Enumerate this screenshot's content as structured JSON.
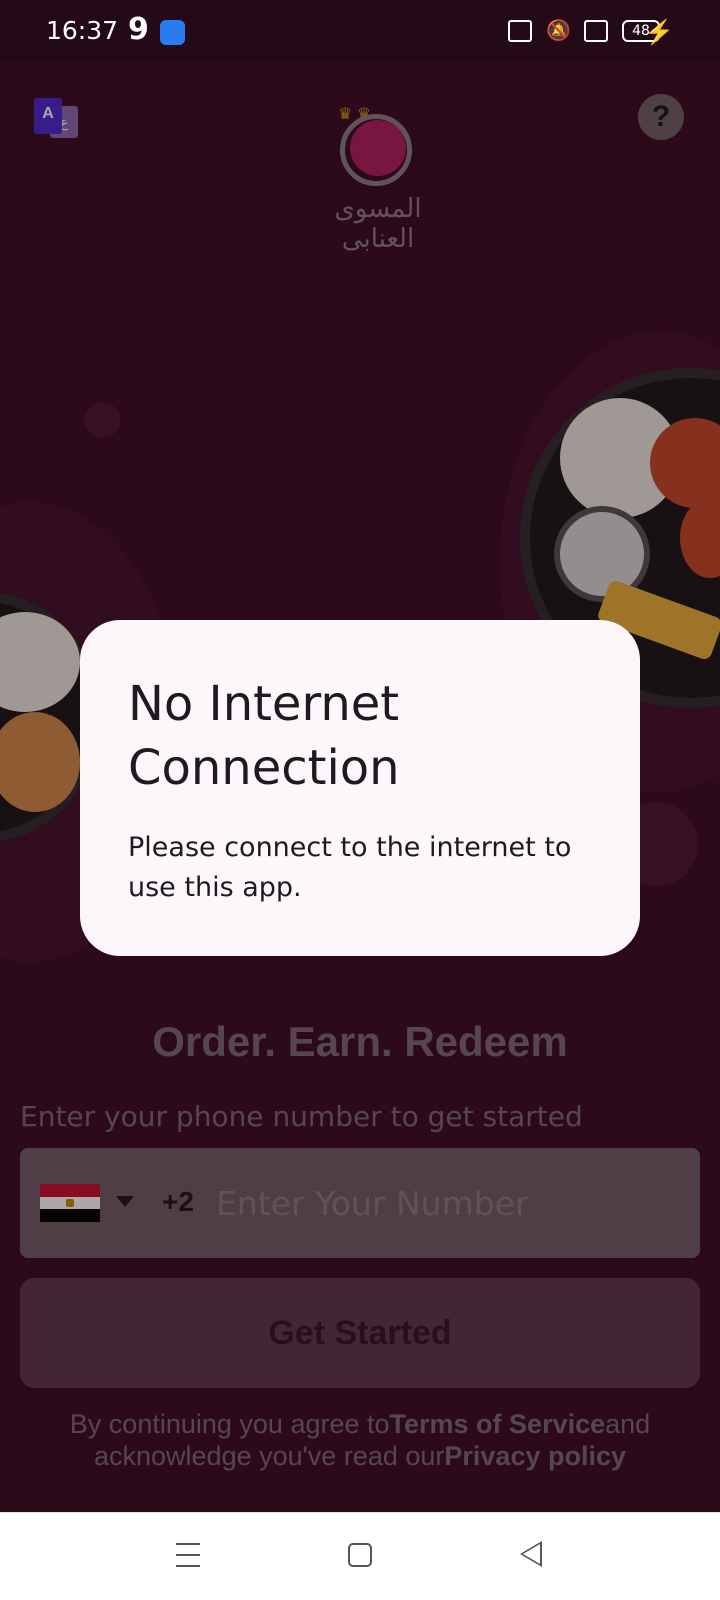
{
  "status_bar": {
    "time": "16:37",
    "carrier_glyph": "9",
    "battery": "48",
    "icons": [
      "notification-app-icon",
      "screen-record-icon",
      "mute-icon",
      "close-box-icon",
      "battery-icon",
      "charging-bolt-icon"
    ]
  },
  "header": {
    "language_toggle": {
      "primary": "A",
      "secondary": "ع"
    },
    "help_label": "?",
    "logo_text_line1": "المسوى",
    "logo_text_line2": "العنابى"
  },
  "dialog": {
    "title": "No Internet Connection",
    "body": "Please connect to the internet to use this app."
  },
  "main": {
    "tagline": "Order. Earn. Redeem",
    "subtitle": "Enter your phone number to get started",
    "phone": {
      "country": "Egypt",
      "dial_code": "+2",
      "value": "",
      "placeholder": "Enter Your Number"
    },
    "get_started_label": "Get Started",
    "legal": {
      "prefix": "By continuing you agree to",
      "terms": "Terms of Service",
      "middle": "and acknowledge you've read our",
      "privacy": "Privacy policy"
    }
  },
  "colors": {
    "background": "#3b0e24",
    "dialog": "#fdf7fb",
    "button": "#5c3a4c",
    "input": "#6f5e66"
  }
}
